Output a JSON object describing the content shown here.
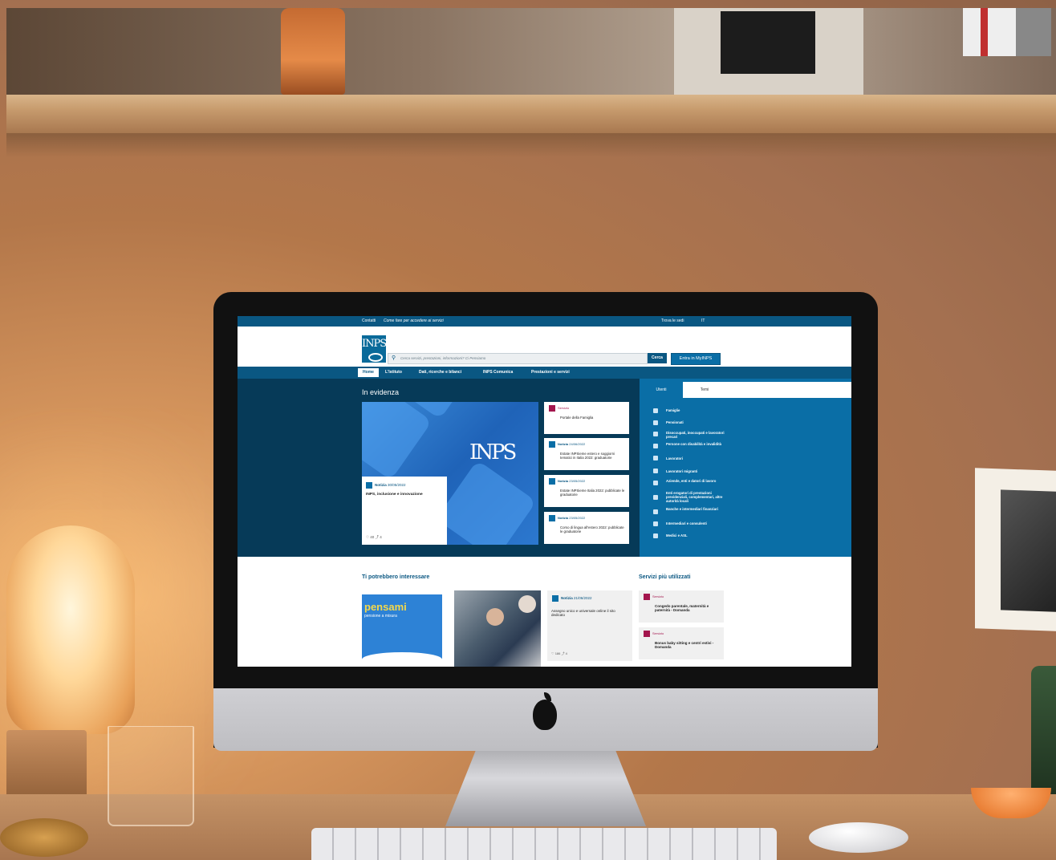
{
  "page": {
    "topbar": {
      "left1": "Contatti",
      "left2": "Come fare per accedere ai servizi",
      "right1": "Trova le sedi",
      "lang": "IT"
    },
    "header": {
      "logo": "INPS",
      "search_placeholder": "Cerca servizi, prestazioni, informazioni? Ci Pensiamo",
      "search_button": "Cerca",
      "myinps_button": "Entra in MyINPS"
    },
    "nav": [
      "Home",
      "L'Istituto",
      "Dati, ricerche e bilanci",
      "INPS Comunica",
      "Prestazioni e servizi"
    ],
    "hero": {
      "title": "In evidenza",
      "big_logo": "INPS",
      "big_card": {
        "type": "Notizia",
        "date": "30/05/2022",
        "title": "INPS, inclusione e innovazione",
        "likes": "♡ 40 ⤴ 4"
      },
      "side_cards": [
        {
          "type": "Servizio",
          "date": "",
          "title": "Portale della Famiglia"
        },
        {
          "type": "Notizia",
          "date": "24/06/2022",
          "title": "Estate INPSieme estero e soggiorni tematici in Italia 2022: graduatorie"
        },
        {
          "type": "Notizia",
          "date": "23/05/2022",
          "title": "Estate INPSieme Italia 2022: pubblicate le graduatorie"
        },
        {
          "type": "Notizia",
          "date": "23/05/2022",
          "title": "Corso di lingua all'estero 2022: pubblicate le graduatorie"
        }
      ]
    },
    "right_panel": {
      "tab_active": "Utenti",
      "tab_inactive": "Temi",
      "items": [
        "Famiglie",
        "Pensionati",
        "Disoccupati, inoccupati e lavoratori precari",
        "Persone con disabilità e invalidità",
        "Lavoratori",
        "Lavoratori migranti",
        "Aziende, enti e datori di lavoro",
        "Enti erogatori di prestazioni previdenziali, complementari, altre autorità locali",
        "Banche e intermediari finanziari",
        "Intermediari e consulenti",
        "Medici e ASL"
      ]
    },
    "lower": {
      "interest_title": "Ti potrebbero interessare",
      "pensami_word": "pensami",
      "pensami_sub": "pensione a misura",
      "news_card": {
        "type": "Notizia",
        "date": "21/06/2022",
        "title": "Assegno unico e universale online il sito dedicato",
        "likes": "♡ 186 ⤴ 4"
      },
      "services_title": "Servizi più utilizzati",
      "services": [
        {
          "type": "Servizio",
          "title": "Congedo parentale, maternità e paternità - Domanda"
        },
        {
          "type": "Servizio",
          "title": "Bonus baby sitting e centri estivi - Domanda"
        }
      ]
    }
  }
}
